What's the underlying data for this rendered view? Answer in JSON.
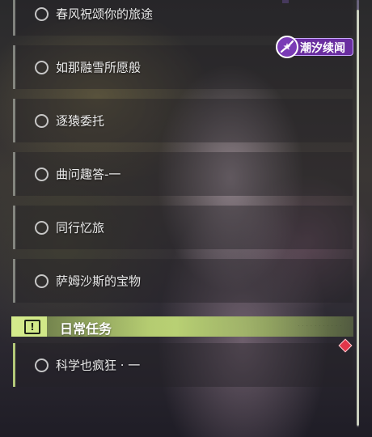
{
  "event_badge": {
    "label": "潮汐续闻",
    "icon": "star-swirl-icon",
    "color": "#6a2ea0"
  },
  "quests": [
    {
      "label": "春风祝颂你的旅途",
      "status_icon": "incomplete-circle-icon"
    },
    {
      "label": "如那融雪所愿般",
      "status_icon": "incomplete-circle-icon"
    },
    {
      "label": "逐猿委托",
      "status_icon": "incomplete-circle-icon"
    },
    {
      "label": "曲问趣答-一",
      "status_icon": "incomplete-circle-icon"
    },
    {
      "label": "同行忆旅",
      "status_icon": "incomplete-circle-icon"
    },
    {
      "label": "萨姆沙斯的宝物",
      "status_icon": "incomplete-circle-icon"
    }
  ],
  "daily_section": {
    "title": "日常任务",
    "icon": "exclamation-box-icon",
    "accent": "#d4eb8c",
    "quests": [
      {
        "label": "科学也疯狂 · 一",
        "status_icon": "incomplete-circle-icon",
        "marker": "red-diamond-icon"
      }
    ]
  }
}
